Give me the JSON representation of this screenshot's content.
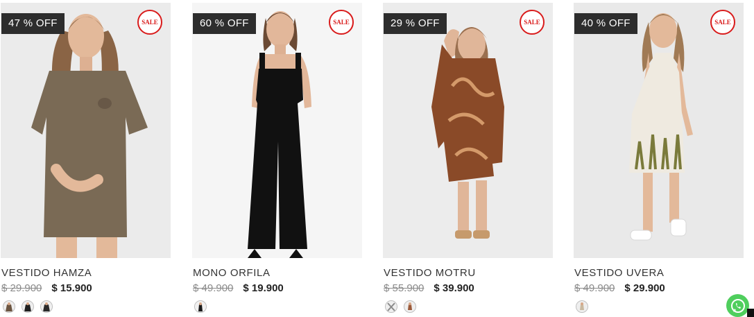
{
  "products": [
    {
      "discount": "47 %  OFF",
      "sale_badge": "SALE",
      "name": "VESTIDO HAMZA",
      "old_price": "$ 29.900",
      "new_price": "$ 15.900",
      "swatches": [
        "#6b5541",
        "#1f1f1f",
        "#2a2a2a"
      ],
      "garment_color": "#7a6a55"
    },
    {
      "discount": "60 %  OFF",
      "sale_badge": "SALE",
      "name": "MONO ORFILA",
      "old_price": "$ 49.900",
      "new_price": "$ 19.900",
      "swatches": [
        "#2a2a2a"
      ],
      "garment_color": "#111111"
    },
    {
      "discount": "29 %  OFF",
      "sale_badge": "SALE",
      "name": "VESTIDO MOTRU",
      "old_price": "$ 55.900",
      "new_price": "$ 39.900",
      "swatches": [
        "#8a8a8a",
        "#9b5a3a"
      ],
      "garment_color": "#8a4a28"
    },
    {
      "discount": "40 %  OFF",
      "sale_badge": "SALE",
      "name": "VESTIDO UVERA",
      "old_price": "$ 49.900",
      "new_price": "$ 29.900",
      "swatches": [
        "#c9b9a0"
      ],
      "garment_color": "#efeae0"
    }
  ],
  "colors": {
    "discount_bg": "#2d2d2d",
    "sale_red": "#d91b1b",
    "whatsapp_green": "#4fce5d"
  },
  "icons": {
    "whatsapp": "whatsapp-icon"
  }
}
